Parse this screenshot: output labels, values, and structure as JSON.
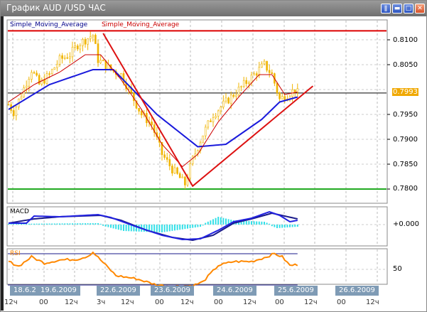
{
  "window": {
    "title": "График AUD /USD  ЧАС",
    "buttons": [
      "pause",
      "minimize",
      "maximize",
      "close"
    ]
  },
  "indicators": {
    "ma1_label": "Simple_Moving_Average",
    "ma2_label": "Simple_Moving_Average",
    "macd_label": "MACD",
    "rsi_label": "RSI"
  },
  "price_axis": {
    "ticks": [
      "0.8100",
      "0.8050",
      "0.7950",
      "0.7900",
      "0.7850",
      "0.7800"
    ],
    "current": "0.7993"
  },
  "macd_axis": {
    "ticks": [
      "+0.000"
    ]
  },
  "rsi_axis": {
    "ticks": [
      "50"
    ]
  },
  "dates": [
    "18.6.2",
    "19.6.2009",
    "22.6.2009",
    "23.6.2009",
    "24.6.2009",
    "25.6.2009",
    "26.6.2009"
  ],
  "times": [
    "12ч",
    "00",
    "12ч",
    "3ч",
    "12ч",
    "00",
    "12ч",
    "00",
    "12ч",
    "00",
    "12ч",
    "00",
    "12ч"
  ],
  "colors": {
    "bull": "#f0b400",
    "ma_fast": "#cc0000",
    "ma_slow": "#1a1adc",
    "resistance": "#dd0000",
    "support": "#22aa22",
    "trendline": "#dd1111",
    "macd_hist": "#33e0e8",
    "rsi": "#ff8800",
    "date_bg": "#7f9bb5"
  },
  "chart_data": [
    {
      "type": "candlestick",
      "title": "AUD/USD H1",
      "price_keypoints": [
        [
          0,
          0.797
        ],
        [
          2,
          0.7955
        ],
        [
          5,
          0.799
        ],
        [
          9,
          0.804
        ],
        [
          12,
          0.801
        ],
        [
          16,
          0.803
        ],
        [
          20,
          0.806
        ],
        [
          24,
          0.807
        ],
        [
          27,
          0.809
        ],
        [
          33,
          0.811
        ],
        [
          35,
          0.806
        ],
        [
          40,
          0.804
        ],
        [
          44,
          0.803
        ],
        [
          48,
          0.799
        ],
        [
          52,
          0.795
        ],
        [
          56,
          0.793
        ],
        [
          60,
          0.787
        ],
        [
          64,
          0.784
        ],
        [
          69,
          0.781
        ],
        [
          72,
          0.786
        ],
        [
          76,
          0.791
        ],
        [
          80,
          0.795
        ],
        [
          84,
          0.797
        ],
        [
          88,
          0.799
        ],
        [
          92,
          0.801
        ],
        [
          96,
          0.803
        ],
        [
          100,
          0.805
        ],
        [
          103,
          0.803
        ],
        [
          106,
          0.798
        ],
        [
          109,
          0.799
        ],
        [
          112,
          0.8
        ],
        [
          113,
          0.7993
        ]
      ],
      "ma_slow": [
        [
          0,
          0.796
        ],
        [
          16,
          0.801
        ],
        [
          33,
          0.804
        ],
        [
          41,
          0.804
        ],
        [
          58,
          0.795
        ],
        [
          74,
          0.7885
        ],
        [
          85,
          0.789
        ],
        [
          99,
          0.794
        ],
        [
          106,
          0.7975
        ],
        [
          113,
          0.7985
        ]
      ],
      "ma_fast": [
        [
          0,
          0.7975
        ],
        [
          10,
          0.801
        ],
        [
          20,
          0.8035
        ],
        [
          30,
          0.807
        ],
        [
          36,
          0.807
        ],
        [
          44,
          0.802
        ],
        [
          52,
          0.796
        ],
        [
          60,
          0.789
        ],
        [
          68,
          0.7845
        ],
        [
          74,
          0.787
        ],
        [
          82,
          0.7935
        ],
        [
          90,
          0.7985
        ],
        [
          98,
          0.803
        ],
        [
          103,
          0.803
        ],
        [
          108,
          0.799
        ],
        [
          113,
          0.7995
        ]
      ],
      "levels": [
        0.8118,
        0.78
      ],
      "current_price": 0.7993,
      "trendline": [
        [
          37,
          0.8113
        ],
        [
          72,
          0.7806
        ],
        [
          119,
          0.8007
        ]
      ],
      "ylim": [
        0.778,
        0.8125
      ]
    },
    {
      "type": "line",
      "title": "MACD",
      "main": [
        [
          0,
          0.0002
        ],
        [
          7,
          0.0002
        ],
        [
          10,
          0.0012
        ],
        [
          20,
          0.0011
        ],
        [
          35,
          0.0014
        ],
        [
          40,
          0.001
        ],
        [
          50,
          -0.0003
        ],
        [
          60,
          -0.0015
        ],
        [
          68,
          -0.0021
        ],
        [
          75,
          -0.002
        ],
        [
          82,
          -0.0008
        ],
        [
          88,
          0.0004
        ],
        [
          95,
          0.0009
        ],
        [
          102,
          0.0018
        ],
        [
          106,
          0.0013
        ],
        [
          110,
          0.0004
        ],
        [
          113,
          0.0006
        ]
      ],
      "signal": [
        [
          0,
          0.0002
        ],
        [
          10,
          0.0008
        ],
        [
          20,
          0.0011
        ],
        [
          36,
          0.0013
        ],
        [
          44,
          0.0006
        ],
        [
          54,
          -0.0008
        ],
        [
          64,
          -0.0018
        ],
        [
          72,
          -0.0022
        ],
        [
          80,
          -0.0015
        ],
        [
          88,
          0.0002
        ],
        [
          95,
          0.0008
        ],
        [
          103,
          0.0016
        ],
        [
          108,
          0.0012
        ],
        [
          113,
          0.0008
        ]
      ],
      "histogram": [
        [
          0,
          0
        ],
        [
          35,
          0.0001
        ],
        [
          45,
          -0.0008
        ],
        [
          60,
          -0.001
        ],
        [
          75,
          -0.0002
        ],
        [
          82,
          0.001
        ],
        [
          88,
          0.0005
        ],
        [
          100,
          0.0003
        ],
        [
          105,
          -0.0004
        ],
        [
          113,
          -0.0002
        ]
      ],
      "ylim": [
        -0.0028,
        0.0024
      ]
    },
    {
      "type": "line",
      "title": "RSI",
      "values": [
        [
          0,
          60
        ],
        [
          4,
          54
        ],
        [
          9,
          66
        ],
        [
          14,
          58
        ],
        [
          20,
          62
        ],
        [
          27,
          63
        ],
        [
          31,
          67
        ],
        [
          33,
          72
        ],
        [
          36,
          62
        ],
        [
          42,
          42
        ],
        [
          50,
          38
        ],
        [
          58,
          30
        ],
        [
          64,
          28
        ],
        [
          72,
          29
        ],
        [
          76,
          34
        ],
        [
          82,
          55
        ],
        [
          88,
          60
        ],
        [
          95,
          60
        ],
        [
          100,
          65
        ],
        [
          104,
          70
        ],
        [
          107,
          66
        ],
        [
          110,
          55
        ],
        [
          113,
          56
        ]
      ],
      "levels": [
        70,
        30
      ],
      "ylim": [
        28,
        74
      ]
    }
  ]
}
